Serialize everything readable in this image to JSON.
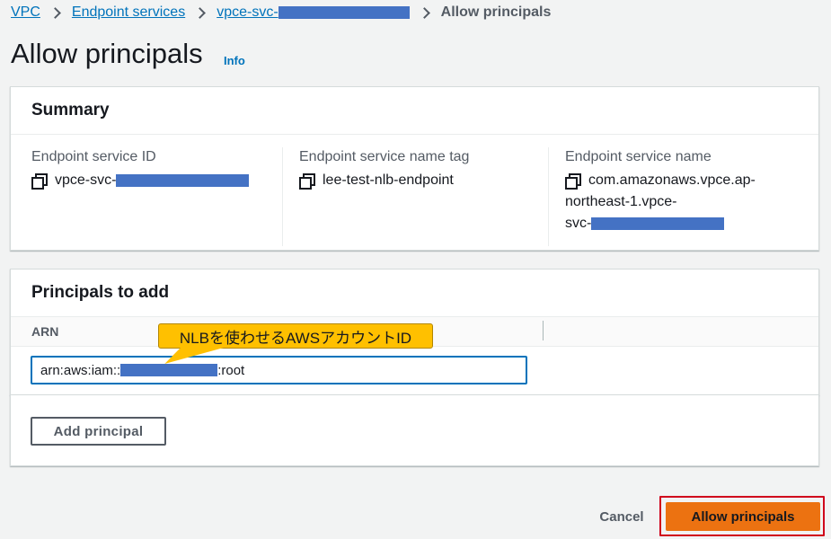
{
  "breadcrumb": {
    "items": [
      "VPC",
      "Endpoint services",
      "vpce-svc-"
    ],
    "current": "Allow principals"
  },
  "page": {
    "title": "Allow principals",
    "info_label": "Info"
  },
  "summary": {
    "heading": "Summary",
    "endpoint_service_id": {
      "label": "Endpoint service ID",
      "value": "vpce-svc-"
    },
    "name_tag": {
      "label": "Endpoint service name tag",
      "value": "lee-test-nlb-endpoint"
    },
    "service_name": {
      "label": "Endpoint service name",
      "line1": "com.amazonaws.vpce.ap-",
      "line2": "northeast-1.vpce-",
      "line3": "svc-"
    }
  },
  "principals": {
    "heading": "Principals to add",
    "column_arn": "ARN",
    "arn_prefix": "arn:aws:iam::",
    "arn_suffix": ":root"
  },
  "annotation": {
    "callout_text": "NLBを使わせるAWSアカウントID",
    "callout_color": "#ffc000",
    "highlight_color": "#d0021b"
  },
  "actions": {
    "add_principal": "Add principal",
    "cancel": "Cancel",
    "allow_principals": "Allow principals"
  },
  "colors": {
    "link": "#0073bb",
    "primary_button": "#ec7211",
    "redaction": "#4472c4"
  }
}
